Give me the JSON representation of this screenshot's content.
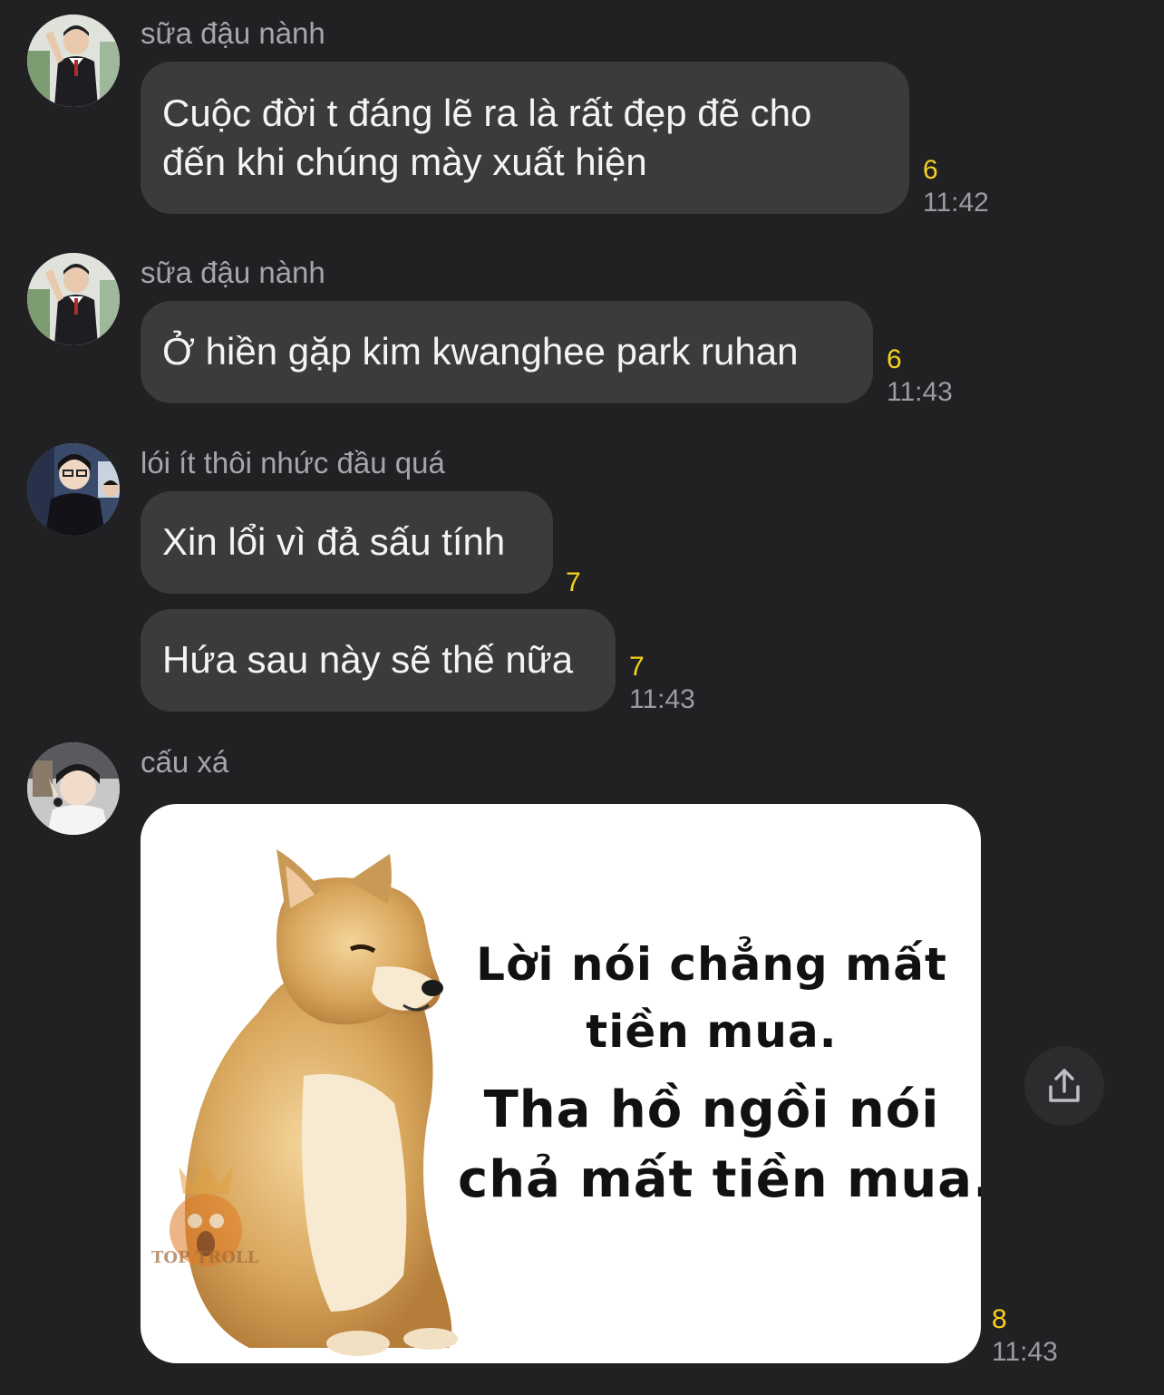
{
  "messages": [
    {
      "sender": "sữa đậu nành",
      "lines": [
        "Cuộc đời t đáng lẽ ra là rất đẹp đẽ cho",
        "đến khi chúng mày xuất hiện"
      ],
      "count": "6",
      "time": "11:42"
    },
    {
      "sender": "sữa đậu nành",
      "lines": [
        "Ở hiền gặp kim kwanghee park ruhan"
      ],
      "count": "6",
      "time": "11:43"
    },
    {
      "sender": "lói ít thôi nhức đầu quá",
      "lines": [
        "Xin lổi vì đả sấu tính"
      ],
      "count": "7"
    },
    {
      "lines": [
        "Hứa sau này sẽ thế nữa"
      ],
      "count": "7",
      "time": "11:43"
    },
    {
      "sender": "cấu xá",
      "image": {
        "caption_lines": [
          "Lời nói chẳng mất",
          "tiền mua.",
          "Tha hồ ngồi nói",
          "chả mất tiền mua."
        ],
        "watermark": "TOP TROLL"
      },
      "count": "8",
      "time": "11:43"
    }
  ],
  "icons": {
    "share": "share-icon",
    "avatar": "avatar"
  },
  "colors": {
    "background": "#212123",
    "bubble": "#3b3b3e",
    "read_count": "#f4d21e",
    "timestamp": "#9c9ca0",
    "sender": "#a6a6aa"
  }
}
